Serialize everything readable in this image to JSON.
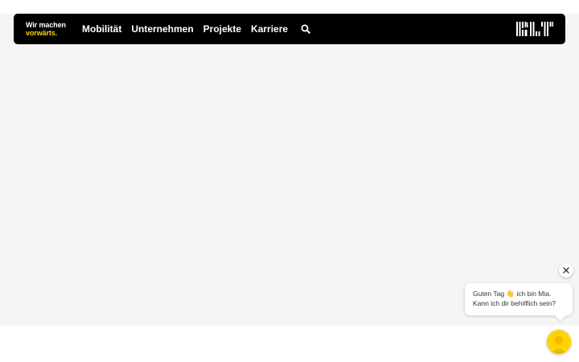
{
  "header": {
    "slogan_line1": "Wir machen",
    "slogan_line2": "vorwärts.",
    "nav_items": [
      "Mobilität",
      "Unternehmen",
      "Projekte",
      "Karriere"
    ],
    "logo_alt": "BLT"
  },
  "chat": {
    "message": "Guten Tag 👋 ich bin Mia. Kann ich dir behilflich sein?"
  },
  "colors": {
    "navbar": "#000000",
    "accent": "#ffd200",
    "page_background": "#f5f5f5"
  },
  "icons": {
    "search": "search-icon",
    "close": "close-icon",
    "chat_avatar": "chat-avatar-icon"
  }
}
